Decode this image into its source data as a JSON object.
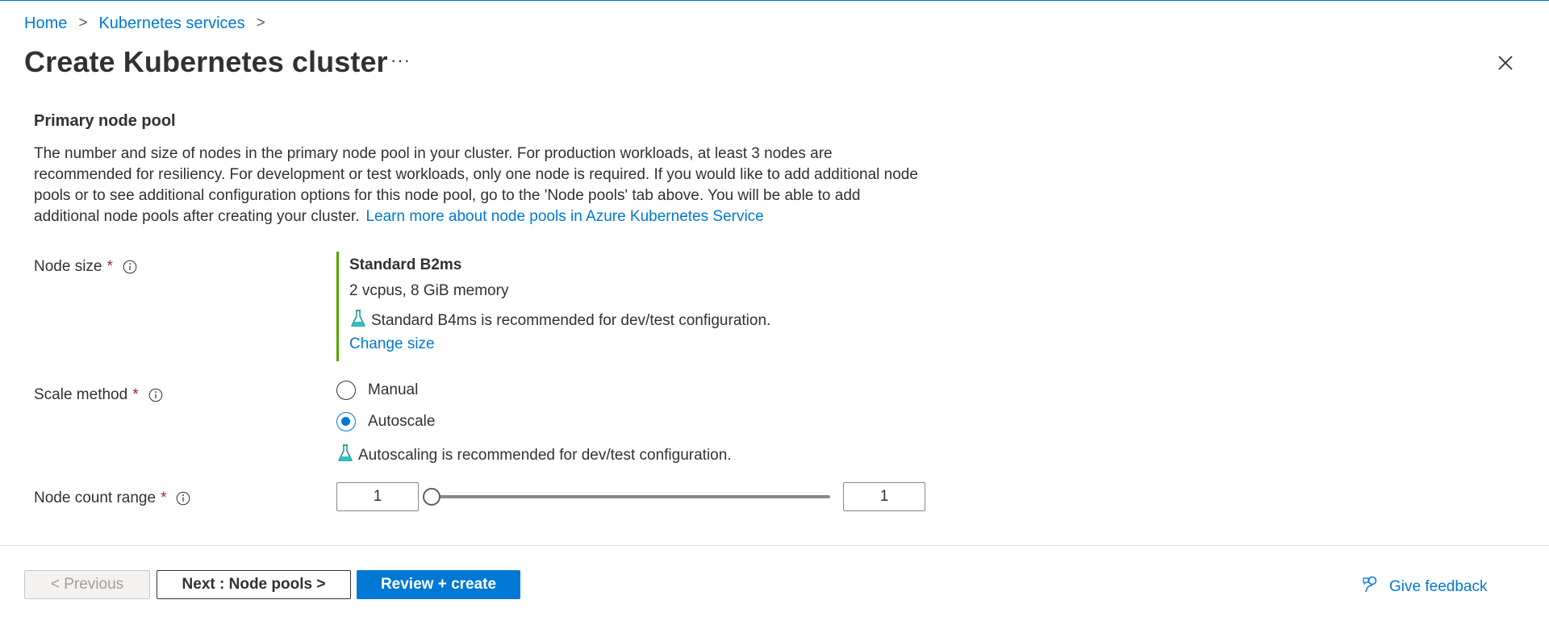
{
  "breadcrumb": {
    "items": [
      "Home",
      "Kubernetes services"
    ],
    "separator": ">"
  },
  "page": {
    "title": "Create Kubernetes cluster",
    "more_label": "···"
  },
  "section": {
    "title": "Primary node pool",
    "description": "The number and size of nodes in the primary node pool in your cluster. For production workloads, at least 3 nodes are recommended for resiliency. For development or test workloads, only one node is required. If you would like to add additional node pools or to see additional configuration options for this node pool, go to the 'Node pools' tab above. You will be able to add additional node pools after creating your cluster.",
    "learn_more": "Learn more about node pools in Azure Kubernetes Service"
  },
  "node_size": {
    "label": "Node size",
    "required_mark": "*",
    "name": "Standard B2ms",
    "spec": "2 vcpus, 8 GiB memory",
    "recommendation": "Standard B4ms is recommended for dev/test configuration.",
    "change_link": "Change size"
  },
  "scale_method": {
    "label": "Scale method",
    "required_mark": "*",
    "options": [
      "Manual",
      "Autoscale"
    ],
    "selected": "Autoscale",
    "recommendation": "Autoscaling is recommended for dev/test configuration."
  },
  "node_count": {
    "label": "Node count range",
    "required_mark": "*",
    "min_value": "1",
    "max_value": "1",
    "slider_level": 0
  },
  "footer": {
    "previous_label": "< Previous",
    "next_label": "Next : Node pools >",
    "review_label": "Review + create",
    "feedback_label": "Give feedback"
  },
  "colors": {
    "accent": "#0078d4",
    "required": "#a4262c",
    "size_bar": "#57a300",
    "text": "#323130"
  },
  "icons": [
    "chevron-right-icon",
    "more-icon",
    "close-icon",
    "info-icon",
    "flask-icon",
    "feedback-icon"
  ]
}
